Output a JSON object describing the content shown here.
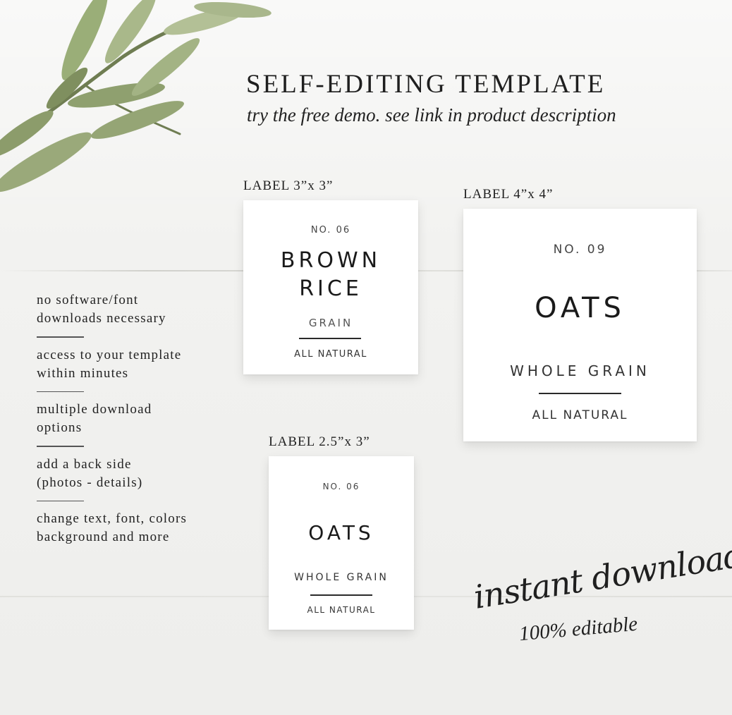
{
  "header": {
    "title": "SELF-EDITING TEMPLATE",
    "subtitle": "try the free demo. see link in product description"
  },
  "features": [
    {
      "line1": "no software/font",
      "line2": "downloads necessary"
    },
    {
      "line1": "access to your template",
      "line2": "within minutes"
    },
    {
      "line1": "multiple download",
      "line2": "options"
    },
    {
      "line1": "add a back side",
      "line2": "(photos - details)"
    },
    {
      "line1": "change text, font, colors",
      "line2": "background and more"
    }
  ],
  "labels": {
    "small": {
      "size": "LABEL 3”x 3”",
      "number": "NO. 06",
      "name_line1": "BROWN",
      "name_line2": "RICE",
      "type": "GRAIN",
      "tagline": "ALL NATURAL"
    },
    "large": {
      "size": "LABEL 4”x 4”",
      "number": "NO. 09",
      "name": "OATS",
      "type": "WHOLE GRAIN",
      "tagline": "ALL NATURAL"
    },
    "narrow": {
      "size": "LABEL 2.5”x 3”",
      "number": "NO. 06",
      "name": "OATS",
      "type": "WHOLE GRAIN",
      "tagline": "ALL NATURAL"
    }
  },
  "footer": {
    "script_text": "instant download",
    "editable_text": "100% editable"
  },
  "decor": {
    "branch": "olive-branch-image",
    "background": "white-wood-planks"
  }
}
